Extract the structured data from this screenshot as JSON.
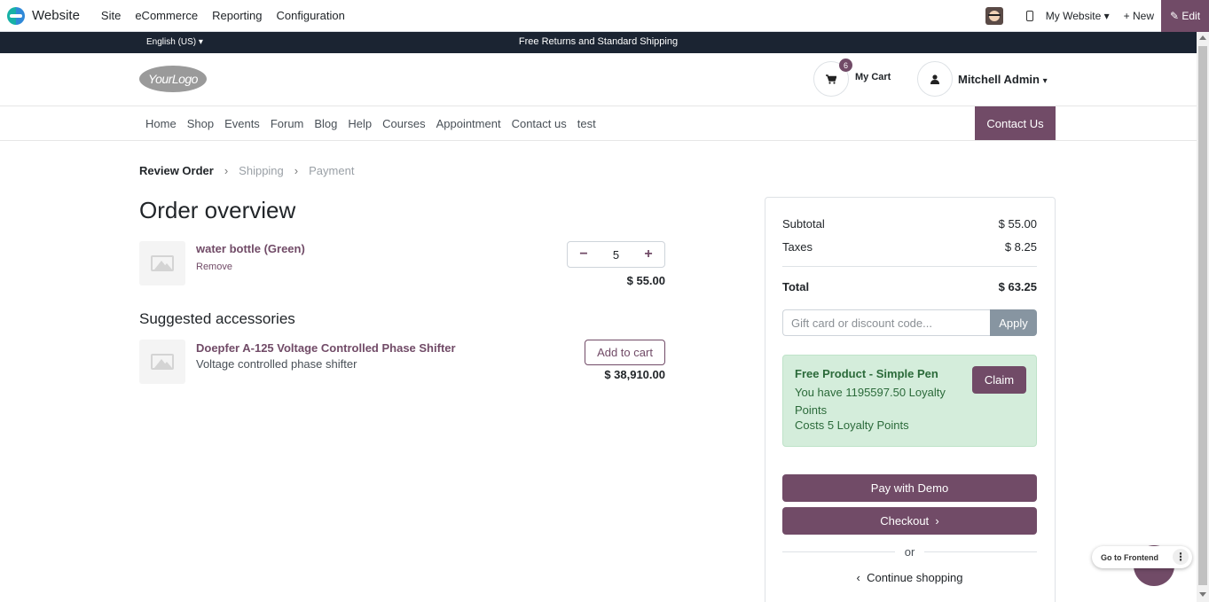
{
  "adminbar": {
    "app_name": "Website",
    "menu": [
      "Site",
      "eCommerce",
      "Reporting",
      "Configuration"
    ],
    "website_label": "My Website",
    "new_label": "New",
    "edit_label": "Edit"
  },
  "announce": {
    "language": "English (US)",
    "message": "Free Returns and Standard Shipping"
  },
  "header": {
    "logo_text": "YourLogo",
    "cart_count": "6",
    "cart_label": "My Cart",
    "user_name": "Mitchell Admin"
  },
  "nav": {
    "items": [
      "Home",
      "Shop",
      "Events",
      "Forum",
      "Blog",
      "Help",
      "Courses",
      "Appointment",
      "Contact us",
      "test"
    ],
    "contact_button": "Contact Us"
  },
  "steps": [
    "Review Order",
    "Shipping",
    "Payment"
  ],
  "page_title": "Order overview",
  "cart_line": {
    "name": "water bottle (Green)",
    "remove_label": "Remove",
    "quantity": "5",
    "price": "$ 55.00"
  },
  "suggested": {
    "title": "Suggested accessories",
    "name": "Doepfer A-125 Voltage Controlled Phase Shifter",
    "description": "Voltage controlled phase shifter",
    "add_label": "Add to cart",
    "price": "$ 38,910.00"
  },
  "summary": {
    "subtotal_label": "Subtotal",
    "subtotal_value": "$ 55.00",
    "taxes_label": "Taxes",
    "taxes_value": "$ 8.25",
    "total_label": "Total",
    "total_value": "$ 63.25",
    "promo_placeholder": "Gift card or discount code...",
    "apply_label": "Apply",
    "reward_title": "Free Product - Simple Pen",
    "reward_points": "You have 1195597.50 Loyalty Points",
    "reward_cost": "Costs 5 Loyalty Points",
    "claim_label": "Claim",
    "pay_demo_label": "Pay with Demo",
    "checkout_label": "Checkout",
    "or_label": "or",
    "continue_label": "Continue shopping"
  },
  "floating": {
    "frontend_label": "Go to Frontend"
  },
  "colors": {
    "brand": "#714b67",
    "announce_bg": "#1b2432",
    "reward_bg": "#d4eddb",
    "apply_bg": "#8795a1"
  }
}
